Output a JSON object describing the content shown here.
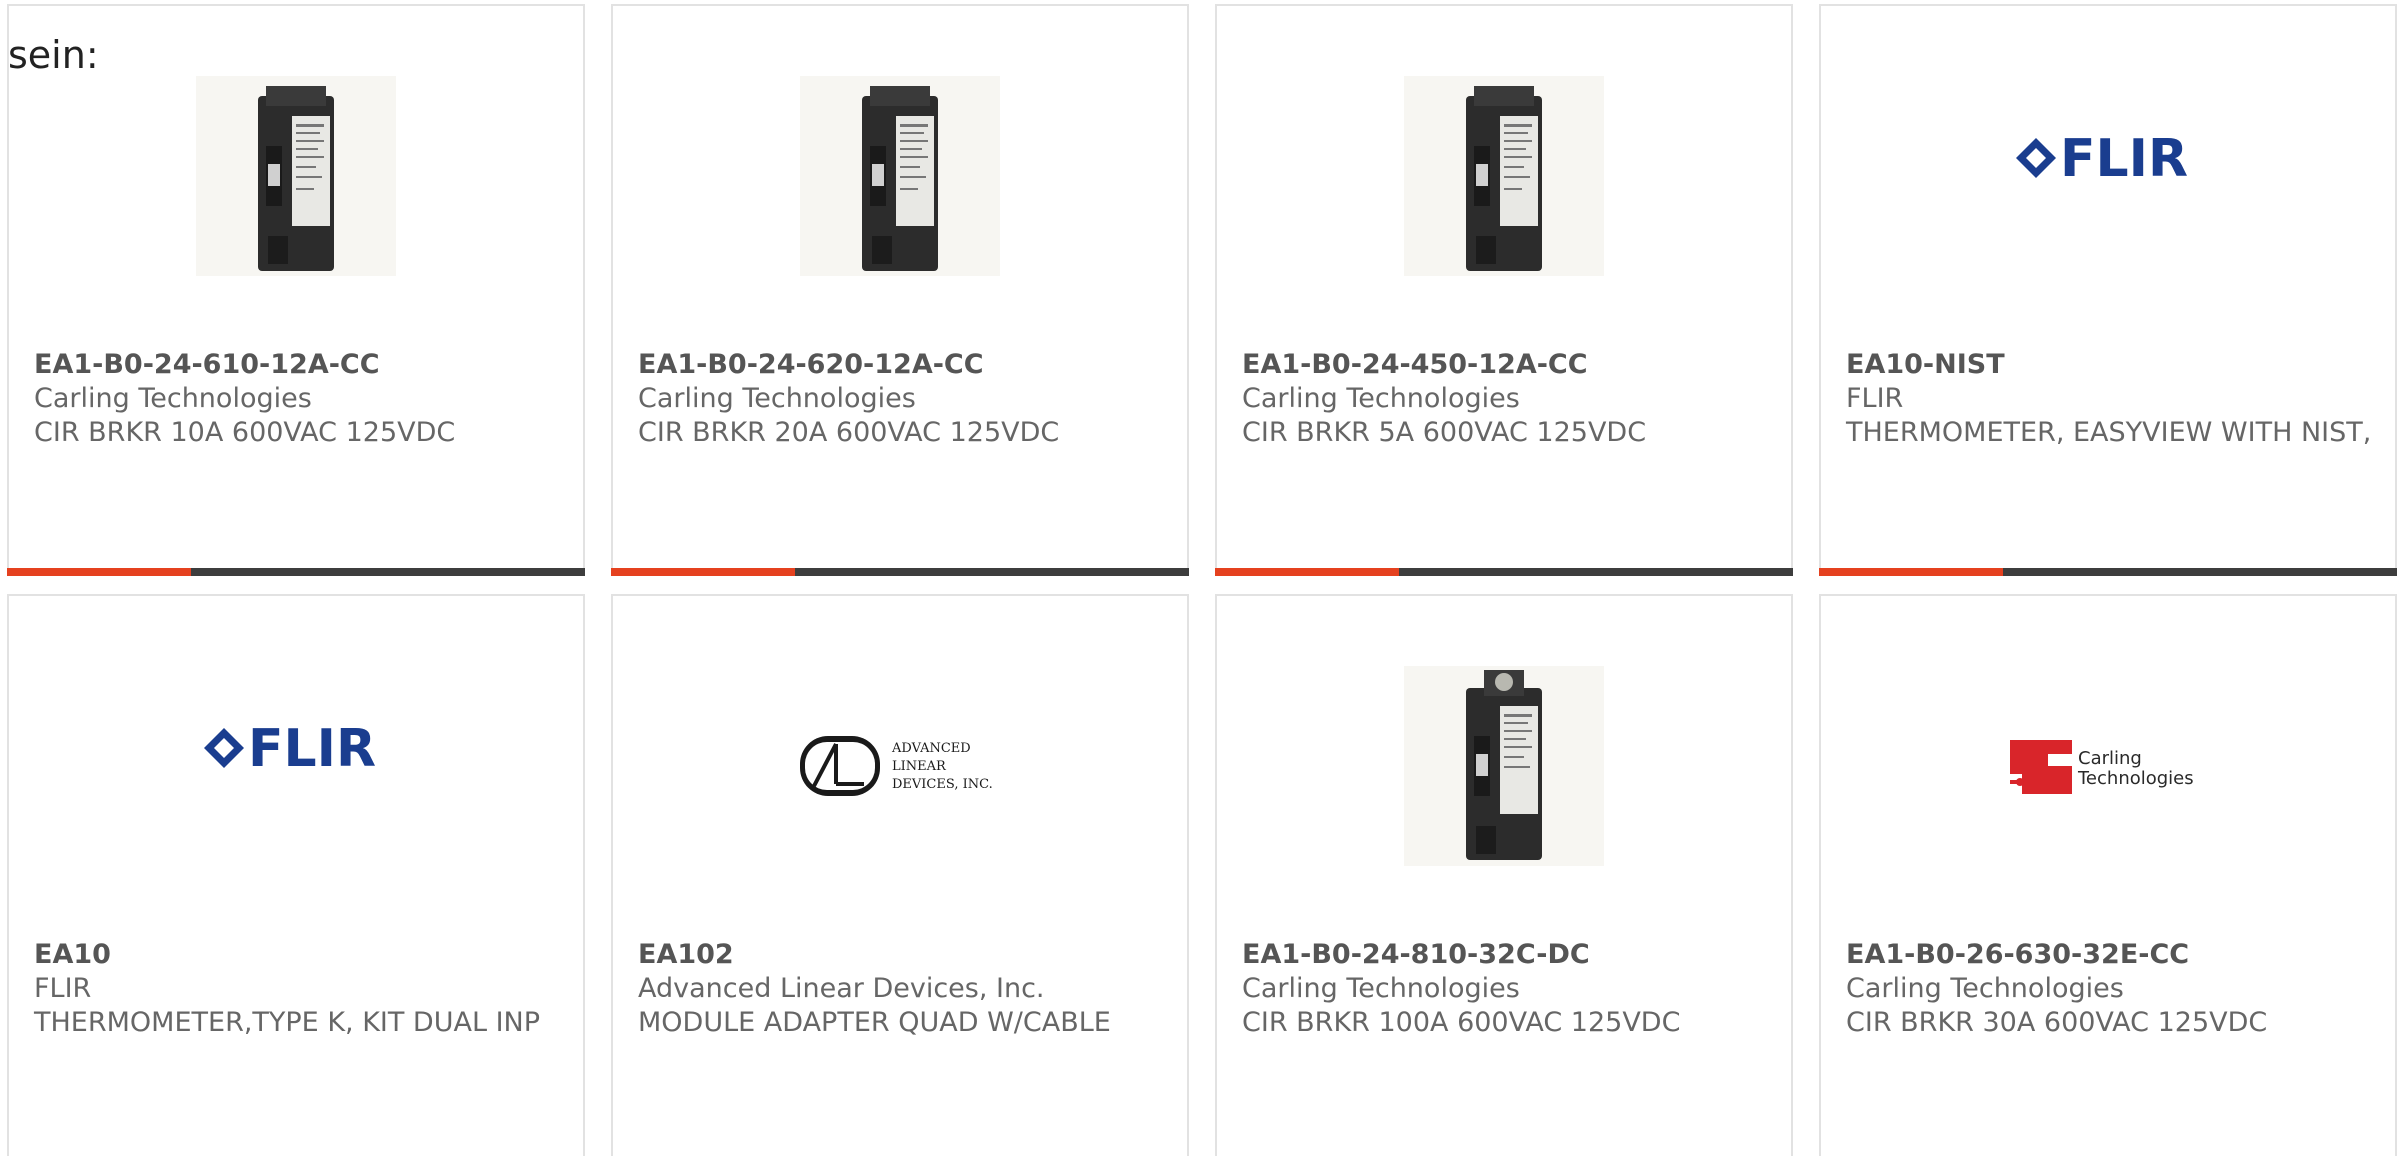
{
  "intro_text": "sein:",
  "colors": {
    "accent_bar": "#e5411f",
    "dark_bar": "#3d3d3d",
    "card_border": "#e2e2e2",
    "text": "#555555",
    "flir_blue": "#1a3d8f",
    "carling_red": "#d9252a"
  },
  "products": [
    {
      "part_number": "EA1-B0-24-610-12A-CC",
      "manufacturer": "Carling Technologies",
      "description": "CIR BRKR 10A 600VAC 125VDC",
      "image": "circuit-breaker"
    },
    {
      "part_number": "EA1-B0-24-620-12A-CC",
      "manufacturer": "Carling Technologies",
      "description": "CIR BRKR 20A 600VAC 125VDC",
      "image": "circuit-breaker"
    },
    {
      "part_number": "EA1-B0-24-450-12A-CC",
      "manufacturer": "Carling Technologies",
      "description": "CIR BRKR 5A 600VAC 125VDC",
      "image": "circuit-breaker"
    },
    {
      "part_number": "EA10-NIST",
      "manufacturer": "FLIR",
      "description": "THERMOMETER, EASYVIEW WITH NIST,",
      "image": "flir-logo",
      "logo_text": "FLIR"
    },
    {
      "part_number": "EA10",
      "manufacturer": "FLIR",
      "description": "THERMOMETER,TYPE K, KIT DUAL INP",
      "image": "flir-logo",
      "logo_text": "FLIR"
    },
    {
      "part_number": "EA102",
      "manufacturer": "Advanced Linear Devices, Inc.",
      "description": "MODULE ADAPTER QUAD W/CABLE",
      "image": "ald-logo",
      "logo_lines": [
        "ADVANCED",
        "LINEAR",
        "DEVICES, INC."
      ]
    },
    {
      "part_number": "EA1-B0-24-810-32C-DC",
      "manufacturer": "Carling Technologies",
      "description": "CIR BRKR 100A 600VAC 125VDC",
      "image": "circuit-breaker-terminal"
    },
    {
      "part_number": "EA1-B0-26-630-32E-CC",
      "manufacturer": "Carling Technologies",
      "description": "CIR BRKR 30A 600VAC 125VDC",
      "image": "carling-logo",
      "logo_lines": [
        "Carling",
        "Technologies"
      ]
    }
  ]
}
